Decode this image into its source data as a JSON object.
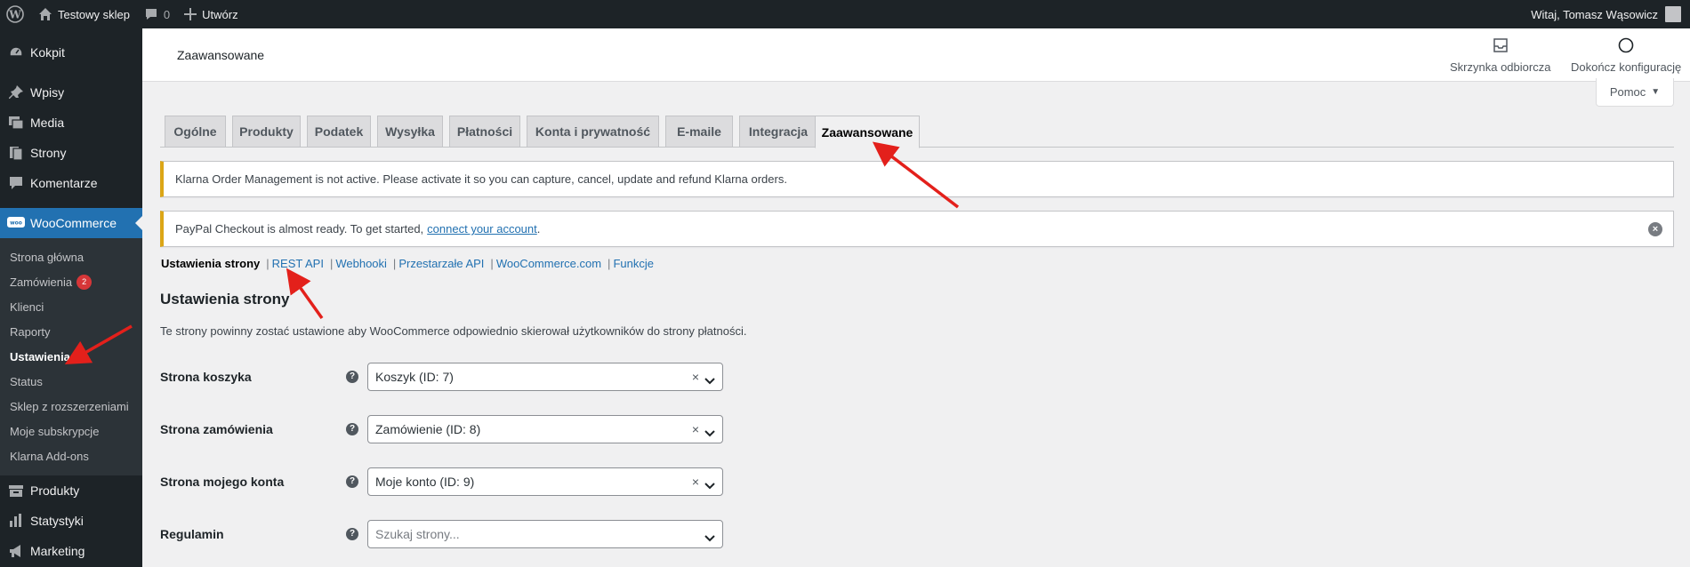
{
  "adminbar": {
    "site_name": "Testowy sklep",
    "comments_count": "0",
    "new_label": "Utwórz",
    "greeting": "Witaj, Tomasz Wąsowicz"
  },
  "sidebar": {
    "items_top": [
      {
        "label": "Kokpit",
        "icon": "dashboard-icon"
      },
      {
        "label": "Wpisy",
        "icon": "pin-icon"
      },
      {
        "label": "Media",
        "icon": "media-icon"
      },
      {
        "label": "Strony",
        "icon": "pages-icon"
      },
      {
        "label": "Komentarze",
        "icon": "comment-icon"
      }
    ],
    "woocommerce": {
      "label": "WooCommerce",
      "icon": "woo-icon"
    },
    "submenu": [
      {
        "label": "Strona główna"
      },
      {
        "label": "Zamówienia",
        "badge": "2"
      },
      {
        "label": "Klienci"
      },
      {
        "label": "Raporty"
      },
      {
        "label": "Ustawienia",
        "current": true
      },
      {
        "label": "Status"
      },
      {
        "label": "Sklep z rozszerzeniami"
      },
      {
        "label": "Moje subskrypcje"
      },
      {
        "label": "Klarna Add-ons"
      }
    ],
    "items_bottom": [
      {
        "label": "Produkty",
        "icon": "archive-icon"
      },
      {
        "label": "Statystyki",
        "icon": "bar-chart-icon"
      },
      {
        "label": "Marketing",
        "icon": "megaphone-icon"
      }
    ]
  },
  "header": {
    "title": "Zaawansowane",
    "inbox_label": "Skrzynka odbiorcza",
    "setup_label": "Dokończ konfigurację"
  },
  "help": {
    "label": "Pomoc"
  },
  "tabs": [
    "Ogólne",
    "Produkty",
    "Podatek",
    "Wysyłka",
    "Płatności",
    "Konta i prywatność",
    "E-maile",
    "Integracja",
    "Zaawansowane"
  ],
  "active_tab": "Zaawansowane",
  "notices": {
    "klarna": "Klarna Order Management is not active. Please activate it so you can capture, cancel, update and refund Klarna orders.",
    "paypal_text": "PayPal Checkout is almost ready. To get started,",
    "paypal_link": "connect your account",
    "paypal_end": "."
  },
  "subnav": {
    "current": "Ustawienia strony",
    "links": [
      "REST API",
      "Webhooki",
      "Przestarzałe API",
      "WooCommerce.com",
      "Funkcje"
    ]
  },
  "section": {
    "title": "Ustawienia strony",
    "description": "Te strony powinny zostać ustawione aby WooCommerce odpowiednio skierował użytkowników do strony płatności."
  },
  "fields": [
    {
      "label": "Strona koszyka",
      "value": "Koszyk (ID: 7)",
      "clear": "×"
    },
    {
      "label": "Strona zamówienia",
      "value": "Zamówienie (ID: 8)",
      "clear": "×"
    },
    {
      "label": "Strona mojego konta",
      "value": "Moje konto (ID: 9)",
      "clear": "×"
    },
    {
      "label": "Regulamin",
      "placeholder": "Szukaj strony..."
    }
  ],
  "colors": {
    "accent": "#2271b1",
    "admin_dark": "#1d2327",
    "warning": "#dba617",
    "annotation": "#e3201b"
  }
}
